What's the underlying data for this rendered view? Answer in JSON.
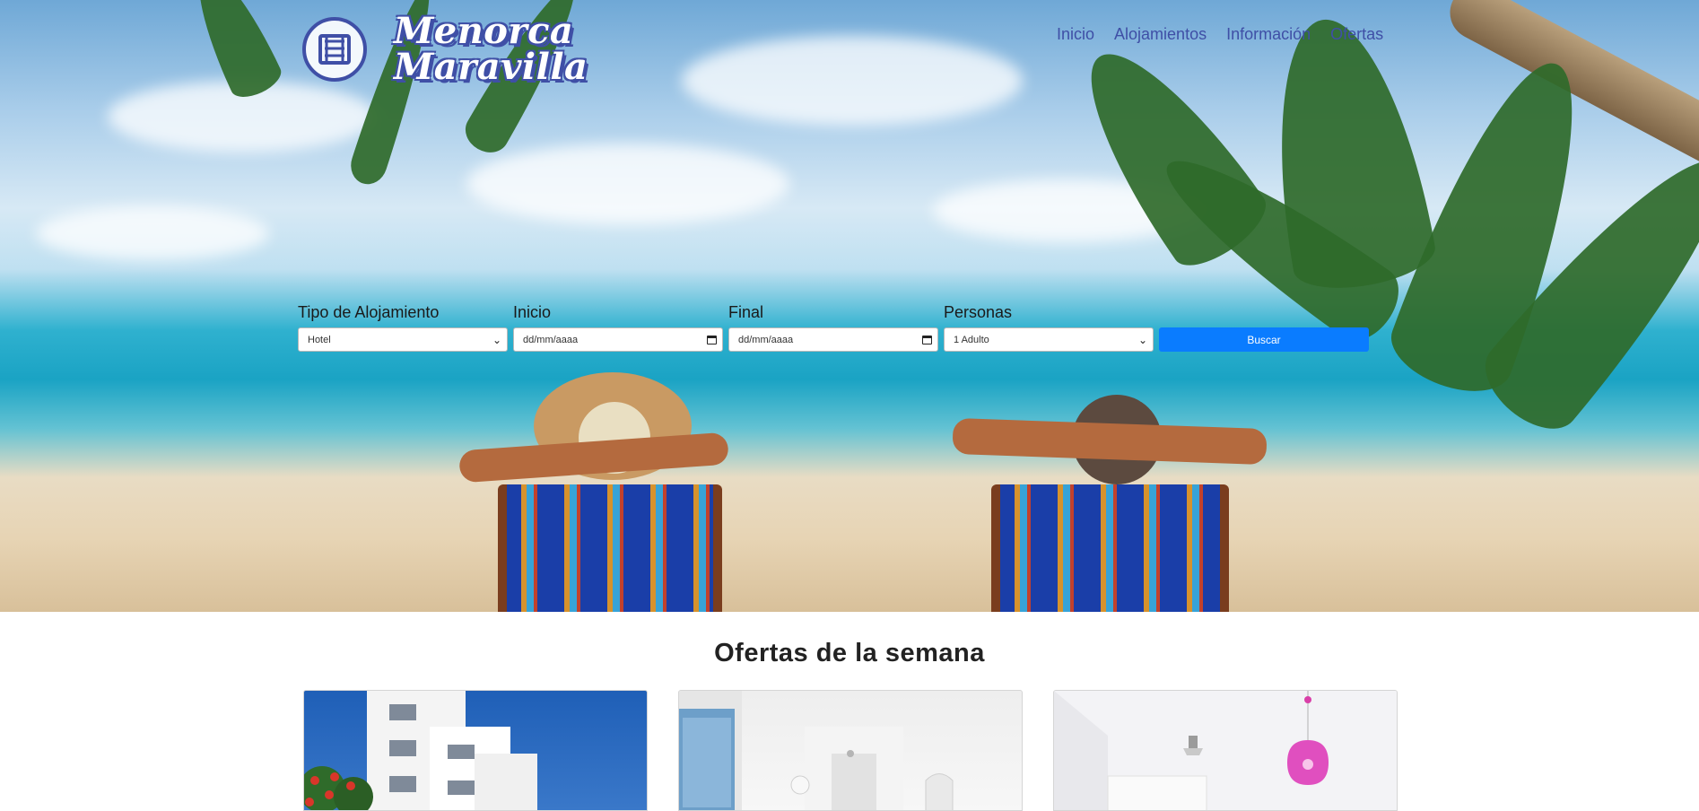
{
  "brand": {
    "name_line1": "Menorca",
    "name_line2": "Maravilla"
  },
  "nav": {
    "items": [
      {
        "label": "Inicio"
      },
      {
        "label": "Alojamientos"
      },
      {
        "label": "Información"
      },
      {
        "label": "Ofertas"
      }
    ]
  },
  "search": {
    "type_label": "Tipo de Alojamiento",
    "type_value": "Hotel",
    "start_label": "Inicio",
    "start_placeholder": "dd/mm/aaaa",
    "end_label": "Final",
    "end_placeholder": "dd/mm/aaaa",
    "people_label": "Personas",
    "people_value": "1 Adulto",
    "submit_label": "Buscar"
  },
  "offers": {
    "title": "Ofertas de la semana"
  },
  "colors": {
    "brand_blue": "#3f4fa6",
    "button_blue": "#0a7cff"
  }
}
